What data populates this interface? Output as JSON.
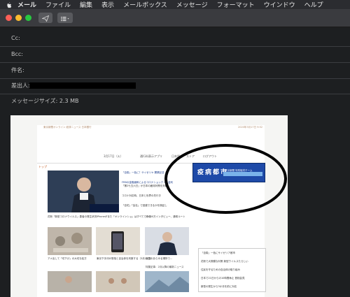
{
  "menubar": {
    "items": [
      "メール",
      "ファイル",
      "編集",
      "表示",
      "メールボックス",
      "メッセージ",
      "フォーマット",
      "ウインドウ",
      "ヘルプ"
    ]
  },
  "toolbar": {
    "send_icon": "paper-plane-icon",
    "format_icon": "list-icon"
  },
  "headers": {
    "cc": "Cc:",
    "bcc": "Bcc:",
    "subject": "件名:",
    "from": "差出人:",
    "size": "メッセージサイズ: 2.3 MB"
  },
  "page": {
    "site": "東京新聞オンライン 経済ニュース 日本銀行",
    "date": "2020年3月17日 9:52",
    "nav": [
      "3月17日（火）",
      "通行料表示アプリ",
      "日本語",
      "ストア",
      "ログアウト"
    ],
    "tab": "トップ",
    "headlines": [
      "「自衛」一色に？サイゼリヤ 開業記念",
      "FRBの金融緩和によるコロナショック・高金利",
      "「第2七五六日」か日本の雇用対策を判断",
      "コロナ対応時、日本と世界の先行き",
      "「自宅」「会社」で回避できるかを検証し",
      "15000万インタビュー、通常ルート"
    ],
    "captions": [
      "花粉「新型コロナウイルス」患者の発生状況",
      "iPhoneがまた「オンラインショ」はすべてできる",
      "全国のあらゆる場所で...",
      "アメ出して「切下げ」の大切な処方",
      "東京下手沖が首相と自治体を判断する（3月20日）",
      "特集記事：2月以降の最新ニュース"
    ],
    "sidebar": [
      "「自衛」一色にサイゼリア都市",
      "花粉で大規模な対策 新型ウイルスたらしい",
      "住民を守るための自治体の取り組み",
      "日本で21日からの10時間休止 首相会見",
      "新型の発生から3か月を前に対応"
    ]
  },
  "ad": {
    "text": "疫病都市",
    "sub": "東京新聞 特別取材チーム"
  },
  "colors": {
    "menubar": "#2b2c30",
    "toolbar": "#3a3b3f",
    "background": "#1d1f21",
    "accent": "#1e4aa8"
  }
}
